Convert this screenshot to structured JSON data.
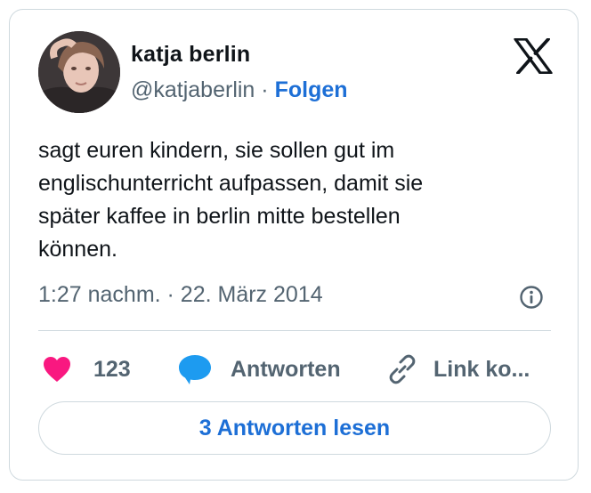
{
  "author": {
    "name": "katja berlin",
    "handle": "@katjaberlin",
    "separator": "·",
    "follow_label": "Folgen"
  },
  "tweet": {
    "lines": [
      "sagt euren kindern, sie sollen gut im",
      "englischunterricht aufpassen, damit sie",
      "später kaffee in berlin mitte bestellen",
      "können."
    ],
    "timestamp": "1:27 nachm. · 22. März 2014"
  },
  "actions": {
    "like_count": "123",
    "reply_label": "Antworten",
    "copy_link_label": "Link ko..."
  },
  "read_replies_label": "3 Antworten lesen",
  "icons": [
    "x-logo-icon",
    "info-icon",
    "heart-icon",
    "speech-bubble-icon",
    "link-icon"
  ],
  "colors": {
    "link": "#1d6fd6",
    "heart": "#f91880",
    "reply_bubble": "#1d9bf0",
    "secondary_text": "#536471",
    "border": "#cfd9de"
  }
}
